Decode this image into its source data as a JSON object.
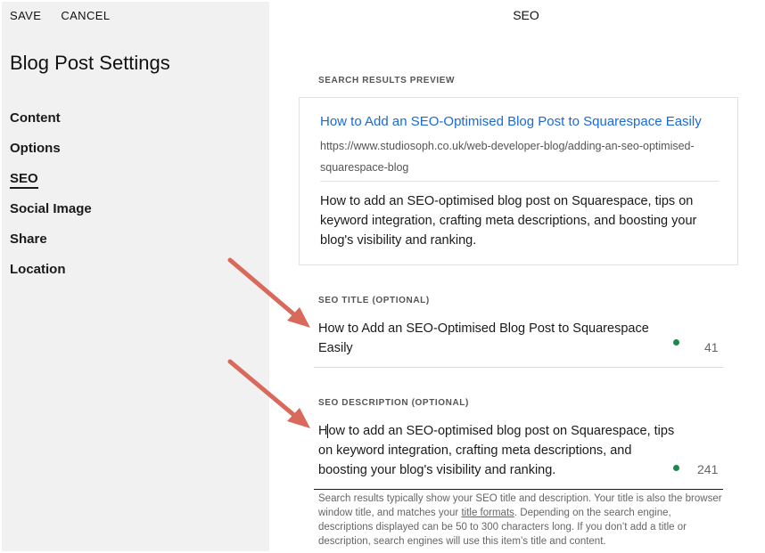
{
  "left_panel": {
    "save_label": "SAVE",
    "cancel_label": "CANCEL",
    "title": "Blog Post Settings",
    "nav": [
      {
        "label": "Content"
      },
      {
        "label": "Options"
      },
      {
        "label": "SEO"
      },
      {
        "label": "Social Image"
      },
      {
        "label": "Share"
      },
      {
        "label": "Location"
      }
    ],
    "active_nav": "SEO"
  },
  "main": {
    "title": "SEO",
    "preview": {
      "label": "SEARCH RESULTS PREVIEW",
      "title": "How to Add an SEO-Optimised Blog Post to Squarespace Easily",
      "url_line1": "https://www.studiosoph.co.uk/web-developer-blog/adding-an-seo-optimised-",
      "url_line2": "squarespace-blog",
      "description": "How to add an SEO-optimised blog post on Squarespace, tips on keyword integration, crafting meta descriptions, and boosting your blog's visibility and ranking."
    },
    "seo_title": {
      "label": "SEO TITLE (OPTIONAL)",
      "value": "How to Add an SEO-Optimised Blog Post to Squarespace Easily",
      "count": "41"
    },
    "seo_description": {
      "label": "SEO DESCRIPTION (OPTIONAL)",
      "value_first_char": "H",
      "value_rest": "ow to add an SEO-optimised blog post on Squarespace, tips on keyword integration, crafting meta descriptions, and boosting your blog's visibility and ranking.",
      "count": "241"
    },
    "help": {
      "text_before": "Search results typically show your SEO title and description. Your title is also the browser window title, and matches your ",
      "link_label": "title formats",
      "text_after": ". Depending on the search engine, descriptions displayed can be 50 to 300 characters long. If you don’t add a title or description, search engines will use this item’s title and content."
    }
  },
  "colors": {
    "link_blue": "#1a6ad6",
    "status_green": "#1a8a4a",
    "annotation_arrow": "#d9695a",
    "panel_bg": "#f1f1f1"
  },
  "icons": [
    "annotation-arrow-icon",
    "status-dot-icon"
  ]
}
